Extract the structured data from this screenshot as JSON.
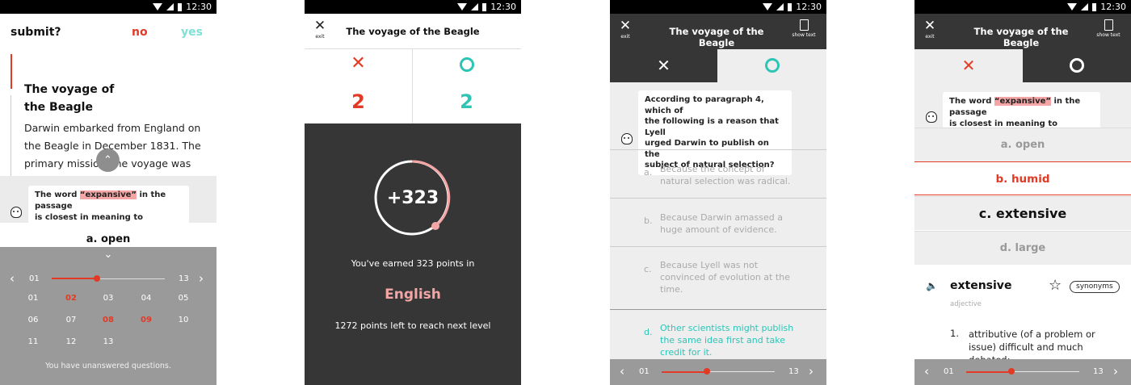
{
  "status": {
    "time": "12:30"
  },
  "s1": {
    "title": "submit?",
    "no": "no",
    "yes": "yes",
    "heading": [
      "The voyage of",
      "the Beagle"
    ],
    "body": [
      "Darwin embarked from England on",
      "the Beagle in December 1831. The",
      "primary missio",
      "the voyage was"
    ],
    "q_pre": "The word ",
    "q_hl": "“expansive”",
    "q_post": " in the passage",
    "q_line2": "is closest in meaning to",
    "option": "a. open",
    "slider_start": "01",
    "slider_end": "13",
    "grid": [
      [
        "01",
        "02",
        "03",
        "04",
        "05"
      ],
      [
        "06",
        "07",
        "08",
        "09",
        "10"
      ],
      [
        "11",
        "12",
        "13"
      ]
    ],
    "unanswered": "You have unanswered questions.",
    "red_cells": [
      "02",
      "08",
      "09"
    ]
  },
  "s2": {
    "exit": "exit",
    "title": "The voyage of the Beagle",
    "wrong_count": "2",
    "right_count": "2",
    "points": "+323",
    "earned": "You've earned 323 points in",
    "subject": "English",
    "left": "1272 points left to reach next level"
  },
  "s3": {
    "exit": "exit",
    "title": "The voyage of the Beagle",
    "show_text": "show text",
    "question": [
      "According to paragraph 4, which of",
      "the following is a reason that Lyell",
      "urged Darwin to publish on the",
      "subject of natural selection?"
    ],
    "options": [
      {
        "letter": "a.",
        "lines": [
          "Because the concept of",
          "natural selection was radical."
        ]
      },
      {
        "letter": "b.",
        "lines": [
          "Because Darwin amassed a",
          "huge amount of evidence."
        ]
      },
      {
        "letter": "c.",
        "lines": [
          "Because Lyell was not",
          "convinced of evolution at the",
          "time."
        ]
      },
      {
        "letter": "d.",
        "lines": [
          "Other scientists might publish",
          "the same idea first and take",
          "credit for it."
        ]
      }
    ],
    "slider_start": "01",
    "slider_end": "13"
  },
  "s4": {
    "exit": "exit",
    "title": "The voyage of the Beagle",
    "show_text": "show text",
    "q_pre": "The word ",
    "q_hl": "“expansive”",
    "q_post": " in the passage",
    "q_line2": "is closest in meaning to",
    "options": [
      "a. open",
      "b. humid",
      "c. extensive",
      "d. large"
    ],
    "word": "extensive",
    "pos": "adjective",
    "synonyms": "synonyms",
    "def_num": "1.",
    "def": [
      "attributive (of a problem or",
      "issue) difficult and much",
      "debated;"
    ],
    "slider_start": "01",
    "slider_end": "13"
  },
  "colors": {
    "red": "#e23a25",
    "teal": "#2ec4b6",
    "dark": "#363636"
  }
}
